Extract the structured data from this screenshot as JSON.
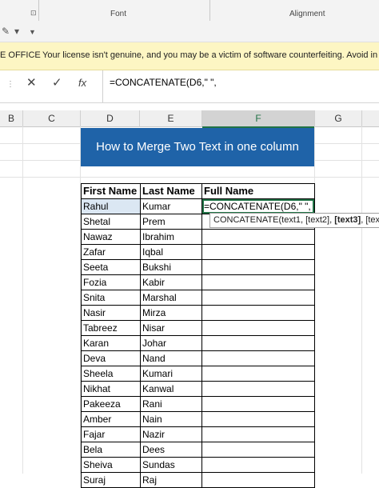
{
  "ribbon": {
    "groups": [
      "Font",
      "Alignment"
    ],
    "launcher_icon": "dialog-launcher-icon"
  },
  "quick_access": {
    "icons": [
      "format-painter-icon",
      "dropdown-icon"
    ]
  },
  "message_bar": {
    "title": "E OFFICE",
    "text": "Your license isn't genuine, and you may be a victim of software counterfeiting. Avoid in"
  },
  "formula_bar": {
    "cancel_icon": "✕",
    "enter_icon": "✓",
    "fx_label": "fx",
    "formula": "=CONCATENATE(D6,\" \","
  },
  "columns": [
    "B",
    "C",
    "D",
    "E",
    "F",
    "G"
  ],
  "active_column": "F",
  "banner_title": "How to Merge Two Text in one column",
  "table": {
    "headers": [
      "First Name",
      "Last Name",
      "Full Name"
    ],
    "rows": [
      [
        "Rahul",
        "Kumar",
        "=CONCATENATE(D6,\" \","
      ],
      [
        "Shetal",
        "Prem",
        ""
      ],
      [
        "Nawaz",
        "Ibrahim",
        ""
      ],
      [
        "Zafar",
        "Iqbal",
        ""
      ],
      [
        "Seeta",
        "Bukshi",
        ""
      ],
      [
        "Fozia",
        "Kabir",
        ""
      ],
      [
        "Snita",
        "Marshal",
        ""
      ],
      [
        "Nasir",
        "Mirza",
        ""
      ],
      [
        "Tabreez",
        "Nisar",
        ""
      ],
      [
        "Karan",
        "Johar",
        ""
      ],
      [
        "Deva",
        "Nand",
        ""
      ],
      [
        "Sheela",
        "Kumari",
        ""
      ],
      [
        "Nikhat",
        "Kanwal",
        ""
      ],
      [
        "Pakeeza",
        "Rani",
        ""
      ],
      [
        "Amber",
        "Nain",
        ""
      ],
      [
        "Fajar",
        "Nazir",
        ""
      ],
      [
        "Bela",
        "Dees",
        ""
      ],
      [
        "Sheiva",
        "Sundas",
        ""
      ],
      [
        "Suraj",
        "Raj",
        ""
      ]
    ]
  },
  "tooltip": {
    "prefix": "CONCATENATE(text1, [text2], ",
    "bold": "[text3]",
    "suffix": ", [tex"
  }
}
